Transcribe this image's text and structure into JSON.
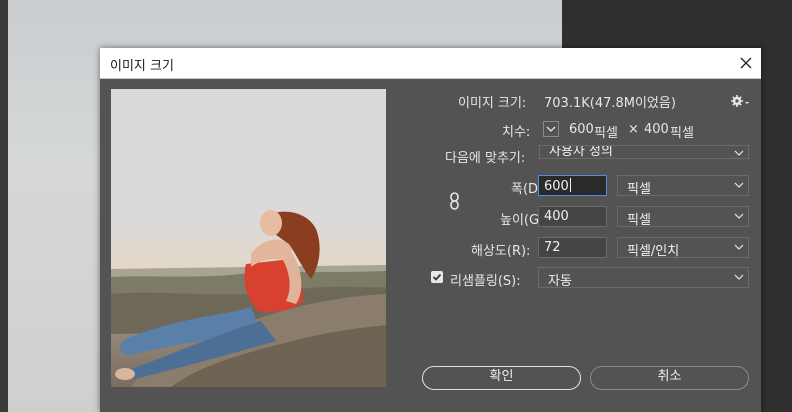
{
  "dialog": {
    "title": "이미지 크기"
  },
  "info": {
    "image_size_label": "이미지 크기:",
    "image_size_value": "703.1K(47.8M이었음)",
    "dimensions_label": "치수:",
    "dim_width": "600",
    "dim_width_unit": "픽셀",
    "dim_times": "×",
    "dim_height": "400",
    "dim_height_unit": "픽셀"
  },
  "fit_to": {
    "label": "다음에 맞추기:",
    "value": "사용자 정의"
  },
  "width": {
    "label": "폭(D):",
    "value": "600",
    "unit": "픽셀"
  },
  "height": {
    "label": "높이(G):",
    "value": "400",
    "unit": "픽셀"
  },
  "resolution": {
    "label": "해상도(R):",
    "value": "72",
    "unit": "픽셀/인치"
  },
  "resample": {
    "label": "리샘플링(S):",
    "checked": true,
    "value": "자동"
  },
  "buttons": {
    "ok": "확인",
    "cancel": "취소"
  },
  "icons": {
    "close": "close-icon",
    "gear": "gear-icon",
    "chain": "chain-link-icon",
    "chevron": "chevron-down-icon",
    "check": "checkmark-icon"
  },
  "colors": {
    "dialog_bg": "#535353",
    "input_bg": "#454545",
    "focus_border": "#4b8fe0",
    "text": "#e6e6e6"
  }
}
